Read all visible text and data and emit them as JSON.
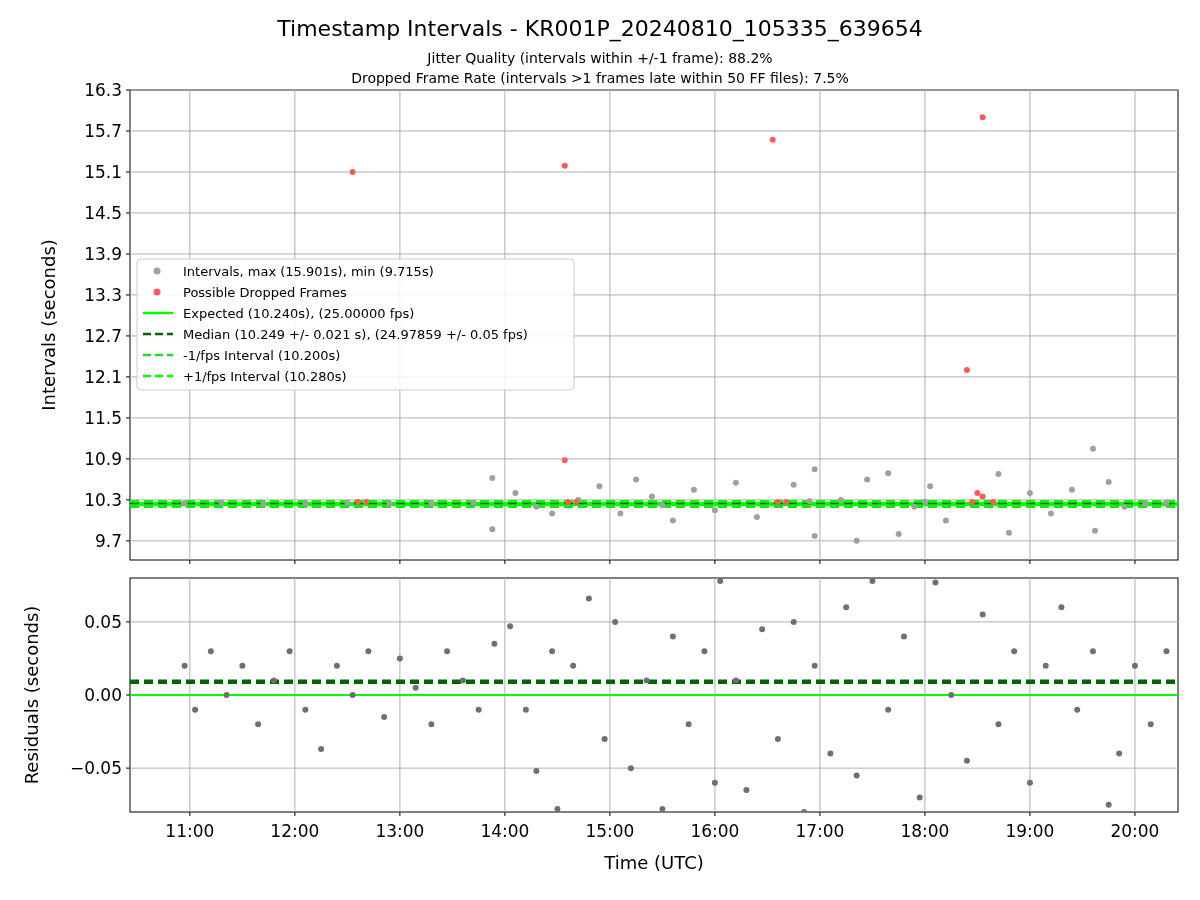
{
  "figure": {
    "title": "Timestamp Intervals - KR001P_20240810_105335_639654",
    "subtitles": [
      "Jitter Quality (intervals within +/-1 frame): 88.2%",
      "Dropped Frame Rate (intervals >1 frames late within 50 FF files): 7.5%"
    ]
  },
  "top_chart": {
    "chart_data": {
      "type": "scatter",
      "ylabel": "Intervals (seconds)",
      "xlim": [
        10.43,
        20.41
      ],
      "ylim": [
        9.42,
        16.3
      ],
      "grid": true,
      "legend": "center left",
      "yticks": [
        {
          "value": 9.7,
          "label": "9.7"
        },
        {
          "value": 10.3,
          "label": "10.3"
        },
        {
          "value": 10.9,
          "label": "10.9"
        },
        {
          "value": 11.5,
          "label": "11.5"
        },
        {
          "value": 12.1,
          "label": "12.1"
        },
        {
          "value": 12.7,
          "label": "12.7"
        },
        {
          "value": 13.3,
          "label": "13.3"
        },
        {
          "value": 13.9,
          "label": "13.9"
        },
        {
          "value": 14.5,
          "label": "14.5"
        },
        {
          "value": 15.1,
          "label": "15.1"
        },
        {
          "value": 15.7,
          "label": "15.7"
        },
        {
          "value": 16.3,
          "label": "16.3"
        }
      ],
      "series": [
        {
          "name": "Intervals, max (15.901s), min (9.715s)",
          "color": "#a0a0a0",
          "x": [
            10.95,
            11.3,
            11.7,
            12.1,
            12.5,
            12.9,
            13.3,
            13.7,
            13.88,
            13.88,
            14.1,
            14.3,
            14.45,
            14.9,
            15.1,
            15.25,
            15.4,
            15.6,
            15.8,
            16.0,
            16.2,
            16.4,
            16.75,
            16.95,
            16.95,
            17.2,
            17.35,
            17.45,
            17.65,
            17.75,
            17.9,
            18.05,
            18.2,
            18.7,
            18.8,
            19.0,
            19.2,
            19.4,
            19.6,
            19.62,
            19.75,
            19.9,
            20.1,
            20.3,
            14.7,
            15.5,
            16.9,
            18.0
          ],
          "values": [
            10.25,
            10.26,
            10.24,
            10.25,
            10.26,
            10.24,
            10.25,
            10.26,
            10.62,
            9.87,
            10.4,
            10.2,
            10.1,
            10.5,
            10.1,
            10.6,
            10.35,
            10.0,
            10.45,
            10.15,
            10.55,
            10.05,
            10.52,
            10.75,
            9.77,
            10.3,
            9.7,
            10.6,
            10.69,
            9.8,
            10.2,
            10.5,
            10.0,
            10.68,
            9.82,
            10.4,
            10.1,
            10.45,
            11.05,
            9.85,
            10.56,
            10.2,
            10.25,
            10.26,
            10.3,
            10.22,
            10.28,
            10.27
          ]
        },
        {
          "name": "Possible Dropped Frames",
          "color": "#ff5a5a",
          "x": [
            12.55,
            14.57,
            16.55,
            18.55,
            18.4,
            14.57,
            12.6,
            12.68,
            14.6,
            14.68,
            16.6,
            16.68,
            18.45,
            18.55,
            18.65,
            18.5
          ],
          "values": [
            15.1,
            15.19,
            15.57,
            15.9,
            12.2,
            10.88,
            10.27,
            10.27,
            10.27,
            10.27,
            10.27,
            10.27,
            10.27,
            10.35,
            10.27,
            10.4
          ]
        }
      ],
      "ref_lines": [
        {
          "label": "Expected (10.240s), (25.00000 fps)",
          "axis": "y",
          "value": 10.24,
          "color": "#00ff00"
        },
        {
          "label": "Median (10.249 +/- 0.021 s), (24.97859 +/- 0.05 fps)",
          "axis": "y",
          "value": 10.249,
          "color": "#006400"
        },
        {
          "label": "-1/fps Interval (10.200s)",
          "axis": "y",
          "value": 10.2,
          "color": "#22dd22"
        },
        {
          "label": "+1/fps Interval (10.280s)",
          "axis": "y",
          "value": 10.28,
          "color": "#00ff00"
        }
      ]
    }
  },
  "bottom_chart": {
    "chart_data": {
      "type": "scatter",
      "xlabel": "Time (UTC)",
      "ylabel": "Residuals (seconds)",
      "xlim": [
        10.43,
        20.41
      ],
      "ylim": [
        -0.08,
        0.08
      ],
      "xticks": [
        {
          "value": 11,
          "label": "11:00"
        },
        {
          "value": 12,
          "label": "12:00"
        },
        {
          "value": 13,
          "label": "13:00"
        },
        {
          "value": 14,
          "label": "14:00"
        },
        {
          "value": 15,
          "label": "15:00"
        },
        {
          "value": 16,
          "label": "16:00"
        },
        {
          "value": 17,
          "label": "17:00"
        },
        {
          "value": 18,
          "label": "18:00"
        },
        {
          "value": 19,
          "label": "19:00"
        },
        {
          "value": 20,
          "label": "20:00"
        }
      ],
      "grid": true,
      "yticks": [
        {
          "value": 0.05,
          "label": "0.05"
        },
        {
          "value": 0,
          "label": "0.00"
        },
        {
          "value": -0.05,
          "label": "−0.05"
        }
      ],
      "series": [
        {
          "color": "#707070",
          "x": [
            10.95,
            11.05,
            11.2,
            11.35,
            11.5,
            11.65,
            11.8,
            11.95,
            12.1,
            12.25,
            12.4,
            12.55,
            12.7,
            12.85,
            13.0,
            13.15,
            13.3,
            13.45,
            13.6,
            13.75,
            13.9,
            14.05,
            14.2,
            14.3,
            14.45,
            14.5,
            14.65,
            14.8,
            14.95,
            15.05,
            15.2,
            15.35,
            15.5,
            15.6,
            15.75,
            15.9,
            16.0,
            16.05,
            16.2,
            16.3,
            16.45,
            16.6,
            16.75,
            16.85,
            16.95,
            17.1,
            17.25,
            17.35,
            17.5,
            17.65,
            17.8,
            17.95,
            18.1,
            18.25,
            18.4,
            18.55,
            18.7,
            18.85,
            19.0,
            19.15,
            19.3,
            19.45,
            19.6,
            19.75,
            19.85,
            20.0,
            20.15,
            20.3
          ],
          "values": [
            0.02,
            -0.01,
            0.03,
            0.0,
            0.02,
            -0.02,
            0.01,
            0.03,
            -0.01,
            -0.037,
            0.02,
            0.0,
            0.03,
            -0.015,
            0.025,
            0.005,
            -0.02,
            0.03,
            0.01,
            -0.01,
            0.035,
            0.047,
            -0.01,
            -0.052,
            0.03,
            -0.078,
            0.02,
            0.066,
            -0.03,
            0.05,
            -0.05,
            0.01,
            -0.078,
            0.04,
            -0.02,
            0.03,
            -0.06,
            0.078,
            0.01,
            -0.065,
            0.045,
            -0.03,
            0.05,
            -0.08,
            0.02,
            -0.04,
            0.06,
            -0.055,
            0.078,
            -0.01,
            0.04,
            -0.07,
            0.077,
            0.0,
            -0.045,
            0.055,
            -0.02,
            0.03,
            -0.06,
            0.02,
            0.06,
            -0.01,
            0.03,
            -0.075,
            -0.04,
            0.02,
            -0.02,
            0.03
          ]
        }
      ],
      "ref_lines": [
        {
          "axis": "y",
          "value": 0.009,
          "color": "#006400"
        },
        {
          "axis": "y",
          "value": 0,
          "color": "#00ff00"
        }
      ]
    }
  }
}
